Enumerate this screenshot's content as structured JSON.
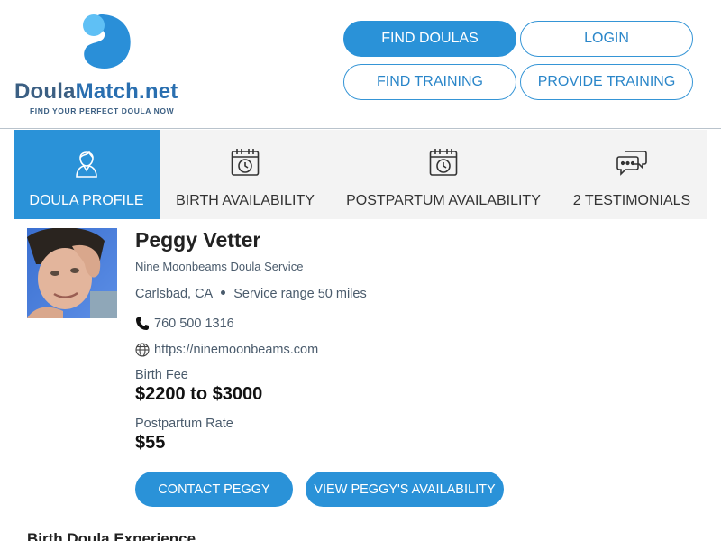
{
  "header": {
    "logo": {
      "name_part1": "Doula",
      "name_part2": "Match.net",
      "tagline": "FIND YOUR PERFECT DOULA NOW"
    },
    "nav": {
      "find_doulas": "FIND DOULAS",
      "login": "LOGIN",
      "find_training": "FIND TRAINING",
      "provide_training": "PROVIDE TRAINING"
    }
  },
  "tabs": [
    {
      "label": "DOULA PROFILE",
      "icon": "doula-person-icon",
      "active": true
    },
    {
      "label": "BIRTH AVAILABILITY",
      "icon": "calendar-clock-icon",
      "active": false
    },
    {
      "label": "POSTPARTUM AVAILABILITY",
      "icon": "calendar-clock-icon",
      "active": false
    },
    {
      "label": "2 TESTIMONIALS",
      "icon": "chat-bubbles-icon",
      "active": false
    }
  ],
  "profile": {
    "name": "Peggy Vetter",
    "service": "Nine Moonbeams Doula Service",
    "location": "Carlsbad, CA",
    "service_range": "Service range 50 miles",
    "phone": "760 500 1316",
    "website": "https://ninemoonbeams.com",
    "birth_fee_label": "Birth Fee",
    "birth_fee": "$2200 to $3000",
    "postpartum_rate_label": "Postpartum Rate",
    "postpartum_rate": "$55",
    "contact_button": "CONTACT PEGGY",
    "availability_button": "VIEW PEGGY'S AVAILABILITY"
  },
  "section": {
    "heading": "Birth Doula Experience"
  },
  "colors": {
    "accent": "#2a92d8",
    "logo_dark": "#3b5f83",
    "logo_blue": "#2a6fb0",
    "tab_bg": "#f3f3f3"
  }
}
